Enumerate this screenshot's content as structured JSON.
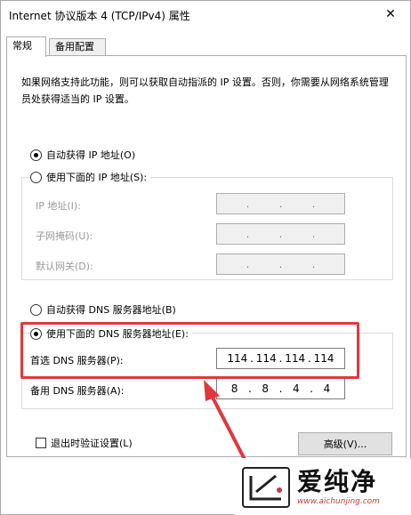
{
  "window": {
    "title": "Internet 协议版本 4 (TCP/IPv4) 属性",
    "close_glyph": "✕"
  },
  "tabs": [
    {
      "label": "常规",
      "active": true
    },
    {
      "label": "备用配置",
      "active": false
    }
  ],
  "description": "如果网络支持此功能，则可以获取自动指派的 IP 设置。否则，你需要从网络系统管理员处获得适当的 IP 设置。",
  "ip_section": {
    "auto_label": "自动获得 IP 地址(O)",
    "auto_checked": true,
    "manual_label": "使用下面的 IP 地址(S):",
    "manual_checked": false,
    "fields": [
      {
        "label": "IP 地址(I):",
        "value": [
          "",
          "",
          "",
          ""
        ]
      },
      {
        "label": "子网掩码(U):",
        "value": [
          "",
          "",
          "",
          ""
        ]
      },
      {
        "label": "默认网关(D):",
        "value": [
          "",
          "",
          "",
          ""
        ]
      }
    ]
  },
  "dns_section": {
    "auto_label": "自动获得 DNS 服务器地址(B)",
    "auto_checked": false,
    "manual_label": "使用下面的 DNS 服务器地址(E):",
    "manual_checked": true,
    "preferred": {
      "label": "首选 DNS 服务器(P):",
      "octets": [
        "114",
        "114",
        "114",
        "114"
      ]
    },
    "alternate": {
      "label": "备用 DNS 服务器(A):",
      "octets": [
        "8",
        "8",
        "4",
        "4"
      ]
    }
  },
  "validate_on_exit": {
    "label": "退出时验证设置(L)",
    "checked": false
  },
  "advanced_button": "高级(V)...",
  "watermark": {
    "text": "爱纯净",
    "url": "www.aichunjing.com"
  },
  "colors": {
    "highlight": "#e0383e",
    "border": "#adadad",
    "disabled_text": "#9a9a9a"
  }
}
